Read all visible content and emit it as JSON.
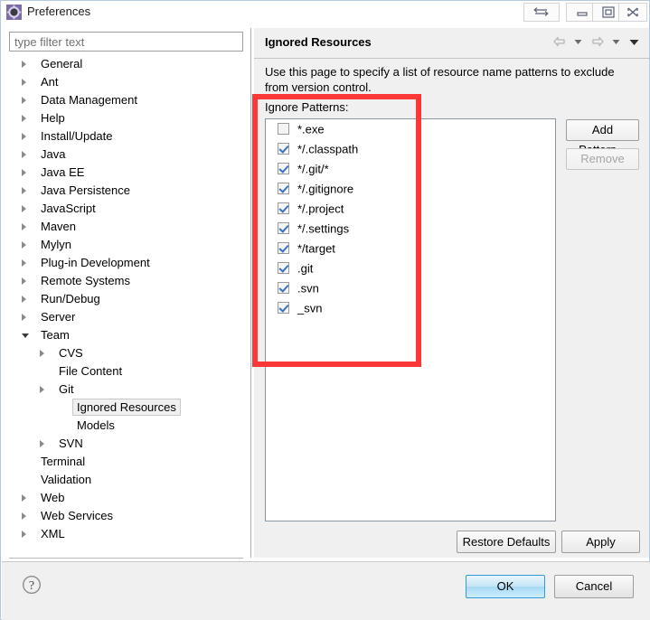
{
  "window": {
    "title": "Preferences",
    "icon": "gear-icon",
    "buttons": {
      "swap": "swap-arrows-icon",
      "minimize": "minimize-icon",
      "maximize": "restore-icon",
      "close": "close-icon"
    }
  },
  "filter": {
    "placeholder": "type filter text",
    "value": ""
  },
  "tree": {
    "items": [
      {
        "label": "General",
        "indent": 0,
        "state": "collapsed",
        "selected": false
      },
      {
        "label": "Ant",
        "indent": 0,
        "state": "collapsed",
        "selected": false
      },
      {
        "label": "Data Management",
        "indent": 0,
        "state": "collapsed",
        "selected": false
      },
      {
        "label": "Help",
        "indent": 0,
        "state": "collapsed",
        "selected": false
      },
      {
        "label": "Install/Update",
        "indent": 0,
        "state": "collapsed",
        "selected": false
      },
      {
        "label": "Java",
        "indent": 0,
        "state": "collapsed",
        "selected": false
      },
      {
        "label": "Java EE",
        "indent": 0,
        "state": "collapsed",
        "selected": false
      },
      {
        "label": "Java Persistence",
        "indent": 0,
        "state": "collapsed",
        "selected": false
      },
      {
        "label": "JavaScript",
        "indent": 0,
        "state": "collapsed",
        "selected": false
      },
      {
        "label": "Maven",
        "indent": 0,
        "state": "collapsed",
        "selected": false
      },
      {
        "label": "Mylyn",
        "indent": 0,
        "state": "collapsed",
        "selected": false
      },
      {
        "label": "Plug-in Development",
        "indent": 0,
        "state": "collapsed",
        "selected": false
      },
      {
        "label": "Remote Systems",
        "indent": 0,
        "state": "collapsed",
        "selected": false
      },
      {
        "label": "Run/Debug",
        "indent": 0,
        "state": "collapsed",
        "selected": false
      },
      {
        "label": "Server",
        "indent": 0,
        "state": "collapsed",
        "selected": false
      },
      {
        "label": "Team",
        "indent": 0,
        "state": "expanded",
        "selected": false
      },
      {
        "label": "CVS",
        "indent": 1,
        "state": "collapsed",
        "selected": false
      },
      {
        "label": "File Content",
        "indent": 1,
        "state": "leaf",
        "selected": false
      },
      {
        "label": "Git",
        "indent": 1,
        "state": "collapsed",
        "selected": false
      },
      {
        "label": "Ignored Resources",
        "indent": 2,
        "state": "leaf",
        "selected": true
      },
      {
        "label": "Models",
        "indent": 2,
        "state": "leaf",
        "selected": false
      },
      {
        "label": "SVN",
        "indent": 1,
        "state": "collapsed",
        "selected": false
      },
      {
        "label": "Terminal",
        "indent": 0,
        "state": "leaf",
        "selected": false
      },
      {
        "label": "Validation",
        "indent": 0,
        "state": "leaf",
        "selected": false
      },
      {
        "label": "Web",
        "indent": 0,
        "state": "collapsed",
        "selected": false
      },
      {
        "label": "Web Services",
        "indent": 0,
        "state": "collapsed",
        "selected": false
      },
      {
        "label": "XML",
        "indent": 0,
        "state": "collapsed",
        "selected": false
      }
    ]
  },
  "page": {
    "title": "Ignored Resources",
    "description": "Use this page to specify a list of resource name patterns to exclude from version control.",
    "section_label": "Ignore Patterns:",
    "nav": {
      "back": "arrow-left-icon",
      "back_menu": "chevron-down-icon",
      "forward": "arrow-right-icon",
      "forward_menu": "chevron-down-icon",
      "view_menu": "chevron-down-icon"
    },
    "patterns": [
      {
        "label": "*.exe",
        "checked": false
      },
      {
        "label": "*/.classpath",
        "checked": true
      },
      {
        "label": "*/.git/*",
        "checked": true
      },
      {
        "label": "*/.gitignore",
        "checked": true
      },
      {
        "label": "*/.project",
        "checked": true
      },
      {
        "label": "*/.settings",
        "checked": true
      },
      {
        "label": "*/target",
        "checked": true
      },
      {
        "label": ".git",
        "checked": true
      },
      {
        "label": ".svn",
        "checked": true
      },
      {
        "label": "_svn",
        "checked": true
      }
    ],
    "side_buttons": {
      "add_pattern": "Add Pattern...",
      "remove": "Remove",
      "remove_enabled": false
    },
    "pane_buttons": {
      "restore_defaults": "Restore Defaults",
      "apply": "Apply"
    }
  },
  "footer": {
    "help": "help-icon",
    "ok": "OK",
    "cancel": "Cancel"
  },
  "colors": {
    "annotation": "#fc3737",
    "default_button_border": "#2e9bd6",
    "checkbox_check": "#3b73c4",
    "selection_background": "#f0f0f0"
  }
}
